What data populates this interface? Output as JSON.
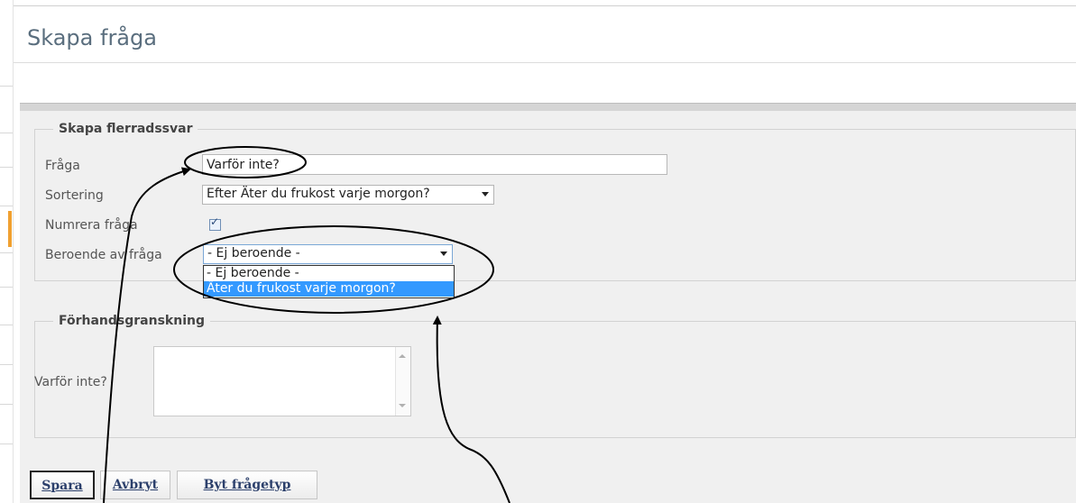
{
  "page": {
    "title": "Skapa fråga"
  },
  "form": {
    "legend": "Skapa flerradssvar",
    "question_label": "Fråga",
    "question_value": "Varför inte?",
    "sort_label": "Sortering",
    "sort_value": "Efter Äter du frukost varje morgon?",
    "number_label": "Numrera fråga",
    "number_checked": true,
    "dependent_label": "Beroende av fråga",
    "dependent_value": "- Ej beroende -",
    "dependent_options": [
      {
        "label": "- Ej beroende -",
        "selected": false
      },
      {
        "label": "Äter du frukost varje morgon?",
        "selected": true
      }
    ]
  },
  "preview": {
    "legend": "Förhandsgranskning",
    "question_label": "Varför inte?"
  },
  "buttons": {
    "save": "Spara",
    "cancel": "Avbryt",
    "change_type": "Byt frågetyp"
  },
  "colors": {
    "highlight": "#3399ff",
    "title": "#5a6e7e",
    "accent": "#f0a030"
  },
  "icons": {
    "checkbox": "checkmark",
    "select_arrow": "triangle-down"
  }
}
